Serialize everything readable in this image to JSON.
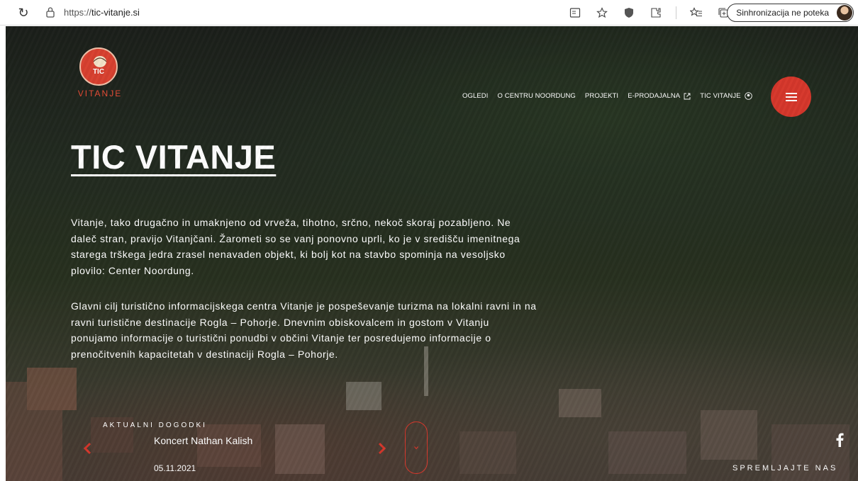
{
  "browser": {
    "url_protocol": "https://",
    "url_host": "tic-vitanje.si",
    "sync_label": "Sinhronizacija ne poteka"
  },
  "logo": {
    "badge": "TIC",
    "name": "VITANJE"
  },
  "nav": {
    "items": [
      "OGLEDI",
      "O CENTRU NOORDUNG",
      "PROJEKTI",
      "E-PRODAJALNA",
      "TIC VITANJE"
    ]
  },
  "hero": {
    "title": "TIC VITANJE",
    "paragraph1": "Vitanje, tako drugačno in umaknjeno od vrveža, tihotno, srčno, nekoč skoraj pozabljeno. Ne daleč stran, pravijo Vitanjčani. Žarometi so se vanj ponovno uprli, ko je v središču imenitnega starega trškega jedra zrasel nenavaden objekt, ki bolj kot na stavbo spominja na vesoljsko plovilo: Center Noordung.",
    "paragraph2": "Glavni cilj turistično informacijskega centra Vitanje je pospeševanje turizma na lokalni ravni in na ravni turistične destinacije Rogla – Pohorje. Dnevnim obiskovalcem in gostom v Vitanju ponujamo informacije o turistični ponudbi v občini Vitanje ter posredujemo informacije o prenočitvenih kapacitetah v destinaciji Rogla – Pohorje."
  },
  "events": {
    "label": "AKTUALNI DOGODKI",
    "title": "Koncert Nathan Kalish",
    "date": "05.11.2021"
  },
  "social": {
    "follow_label": "SPREMLJAJTE NAS"
  },
  "colors": {
    "accent": "#d6372b",
    "text": "#ffffff"
  }
}
